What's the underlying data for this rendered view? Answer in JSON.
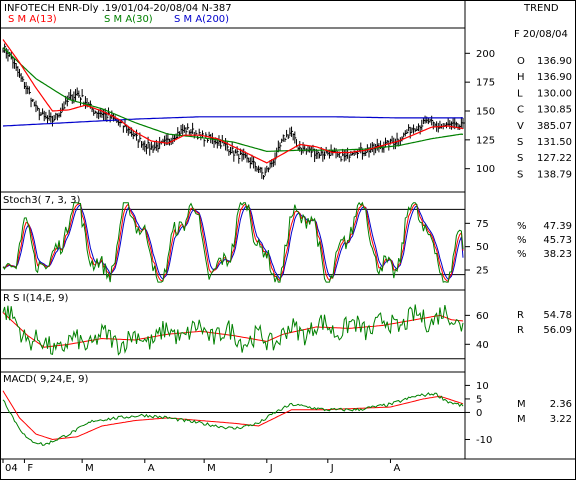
{
  "header": {
    "title": "INFOTECH ENR-Dly .19/01/04-20/08/04  N-387",
    "trend": "TREND",
    "date": "F 20/08/04",
    "sma": [
      {
        "label": "S M A(13)",
        "color": "#ff0000"
      },
      {
        "label": "S M A(30)",
        "color": "#008000"
      },
      {
        "label": "S M A(200)",
        "color": "#0000cc"
      }
    ]
  },
  "right_panel": {
    "price": [
      {
        "k": "O",
        "v": "136.90",
        "color": "#000000"
      },
      {
        "k": "H",
        "v": "136.90",
        "color": "#a08000"
      },
      {
        "k": "L",
        "v": "130.00",
        "color": "#000000"
      },
      {
        "k": "C",
        "v": "130.85",
        "color": "#a08000"
      },
      {
        "k": "V",
        "v": "385.07",
        "color": "#000000"
      },
      {
        "k": "S",
        "v": "131.50",
        "color": "#ff0000"
      },
      {
        "k": "S",
        "v": "127.22",
        "color": "#008000"
      },
      {
        "k": "S",
        "v": "138.79",
        "color": "#0000cc"
      }
    ],
    "stoch": [
      {
        "k": "%",
        "v": "47.39",
        "color": "#008000"
      },
      {
        "k": "%",
        "v": "45.73",
        "color": "#ff0000"
      },
      {
        "k": "%",
        "v": "38.23",
        "color": "#0000cc"
      }
    ],
    "rsi": [
      {
        "k": "R",
        "v": "54.78",
        "color": "#008000"
      },
      {
        "k": "R",
        "v": "56.09",
        "color": "#ff0000"
      }
    ],
    "macd": [
      {
        "k": "M",
        "v": "2.36",
        "color": "#008000"
      },
      {
        "k": "M",
        "v": "3.22",
        "color": "#ff0000"
      }
    ]
  },
  "panel_titles": {
    "stoch": "Stoch3( 7, 3, 3)",
    "rsi": "R S I(14,E, 9)",
    "macd": "MACD( 9,24,E, 9)"
  },
  "x_labels": [
    "04",
    "F",
    "M",
    "A",
    "M",
    "J",
    "J",
    "A"
  ],
  "chart_data": [
    {
      "type": "line",
      "name": "price",
      "ylim": [
        85,
        215
      ],
      "yticks": [
        100,
        125,
        150,
        175,
        200
      ],
      "colors": {
        "bars": "#000000",
        "sma13": "#ff0000",
        "sma30": "#008000",
        "sma200": "#0000cc"
      },
      "keys": [
        [
          0,
          205
        ],
        [
          5,
          196
        ],
        [
          10,
          180
        ],
        [
          15,
          168
        ],
        [
          20,
          152
        ],
        [
          25,
          144
        ],
        [
          30,
          142
        ],
        [
          35,
          150
        ],
        [
          40,
          160
        ],
        [
          45,
          165
        ],
        [
          50,
          158
        ],
        [
          55,
          150
        ],
        [
          60,
          148
        ],
        [
          65,
          145
        ],
        [
          70,
          140
        ],
        [
          75,
          135
        ],
        [
          80,
          128
        ],
        [
          85,
          122
        ],
        [
          90,
          118
        ],
        [
          95,
          120
        ],
        [
          100,
          124
        ],
        [
          105,
          130
        ],
        [
          110,
          134
        ],
        [
          115,
          132
        ],
        [
          120,
          128
        ],
        [
          125,
          126
        ],
        [
          130,
          124
        ],
        [
          135,
          120
        ],
        [
          140,
          114
        ],
        [
          145,
          110
        ],
        [
          150,
          106
        ],
        [
          155,
          100
        ],
        [
          158,
          94
        ],
        [
          162,
          103
        ],
        [
          166,
          112
        ],
        [
          170,
          126
        ],
        [
          175,
          132
        ],
        [
          178,
          120
        ],
        [
          183,
          116
        ],
        [
          188,
          115
        ],
        [
          193,
          113
        ],
        [
          198,
          114
        ],
        [
          203,
          111
        ],
        [
          208,
          110
        ],
        [
          213,
          117
        ],
        [
          218,
          115
        ],
        [
          223,
          117
        ],
        [
          228,
          119
        ],
        [
          233,
          121
        ],
        [
          238,
          124
        ],
        [
          243,
          129
        ],
        [
          248,
          135
        ],
        [
          253,
          138
        ],
        [
          258,
          141
        ],
        [
          263,
          136
        ],
        [
          268,
          137
        ],
        [
          272,
          138
        ],
        [
          275,
          136
        ],
        [
          278,
          137
        ]
      ],
      "sma13_keys": [
        [
          0,
          212
        ],
        [
          10,
          192
        ],
        [
          20,
          170
        ],
        [
          30,
          150
        ],
        [
          40,
          151
        ],
        [
          50,
          155
        ],
        [
          60,
          150
        ],
        [
          70,
          143
        ],
        [
          80,
          132
        ],
        [
          90,
          124
        ],
        [
          100,
          122
        ],
        [
          110,
          129
        ],
        [
          120,
          129
        ],
        [
          130,
          126
        ],
        [
          140,
          119
        ],
        [
          150,
          112
        ],
        [
          160,
          105
        ],
        [
          170,
          113
        ],
        [
          180,
          121
        ],
        [
          190,
          119
        ],
        [
          200,
          114
        ],
        [
          210,
          114
        ],
        [
          220,
          116
        ],
        [
          230,
          120
        ],
        [
          240,
          124
        ],
        [
          250,
          130
        ],
        [
          260,
          136
        ],
        [
          270,
          137
        ],
        [
          278,
          135
        ]
      ],
      "sma30_keys": [
        [
          0,
          205
        ],
        [
          20,
          178
        ],
        [
          40,
          160
        ],
        [
          60,
          152
        ],
        [
          80,
          140
        ],
        [
          100,
          130
        ],
        [
          120,
          127
        ],
        [
          140,
          123
        ],
        [
          160,
          115
        ],
        [
          180,
          116
        ],
        [
          200,
          116
        ],
        [
          220,
          117
        ],
        [
          240,
          120
        ],
        [
          260,
          126
        ],
        [
          278,
          130
        ]
      ],
      "sma200_keys": [
        [
          0,
          137
        ],
        [
          40,
          140
        ],
        [
          80,
          143
        ],
        [
          120,
          145
        ],
        [
          160,
          145
        ],
        [
          200,
          145
        ],
        [
          240,
          144
        ],
        [
          278,
          144
        ]
      ]
    },
    {
      "type": "line",
      "name": "stoch",
      "ylim": [
        10,
        100
      ],
      "yticks": [
        25,
        50,
        75
      ],
      "hlines": [
        20,
        90
      ],
      "colors": {
        "k": "#008000",
        "d": "#ff0000",
        "slow": "#0000cc"
      },
      "last": {
        "k": 47.39,
        "d": 45.73,
        "slow": 38.23
      }
    },
    {
      "type": "line",
      "name": "rsi",
      "ylim": [
        25,
        72
      ],
      "yticks": [
        40,
        60
      ],
      "hlines": [
        30
      ],
      "colors": {
        "rsi": "#008000",
        "signal": "#ff0000"
      },
      "last": {
        "rsi": 54.78,
        "signal": 56.09
      }
    },
    {
      "type": "line",
      "name": "macd",
      "ylim": [
        -15,
        12
      ],
      "yticks": [
        -10,
        0,
        5,
        10
      ],
      "hlines": [
        0
      ],
      "colors": {
        "macd": "#008000",
        "signal": "#ff0000"
      },
      "last": {
        "macd": 2.36,
        "signal": 3.22
      }
    }
  ]
}
